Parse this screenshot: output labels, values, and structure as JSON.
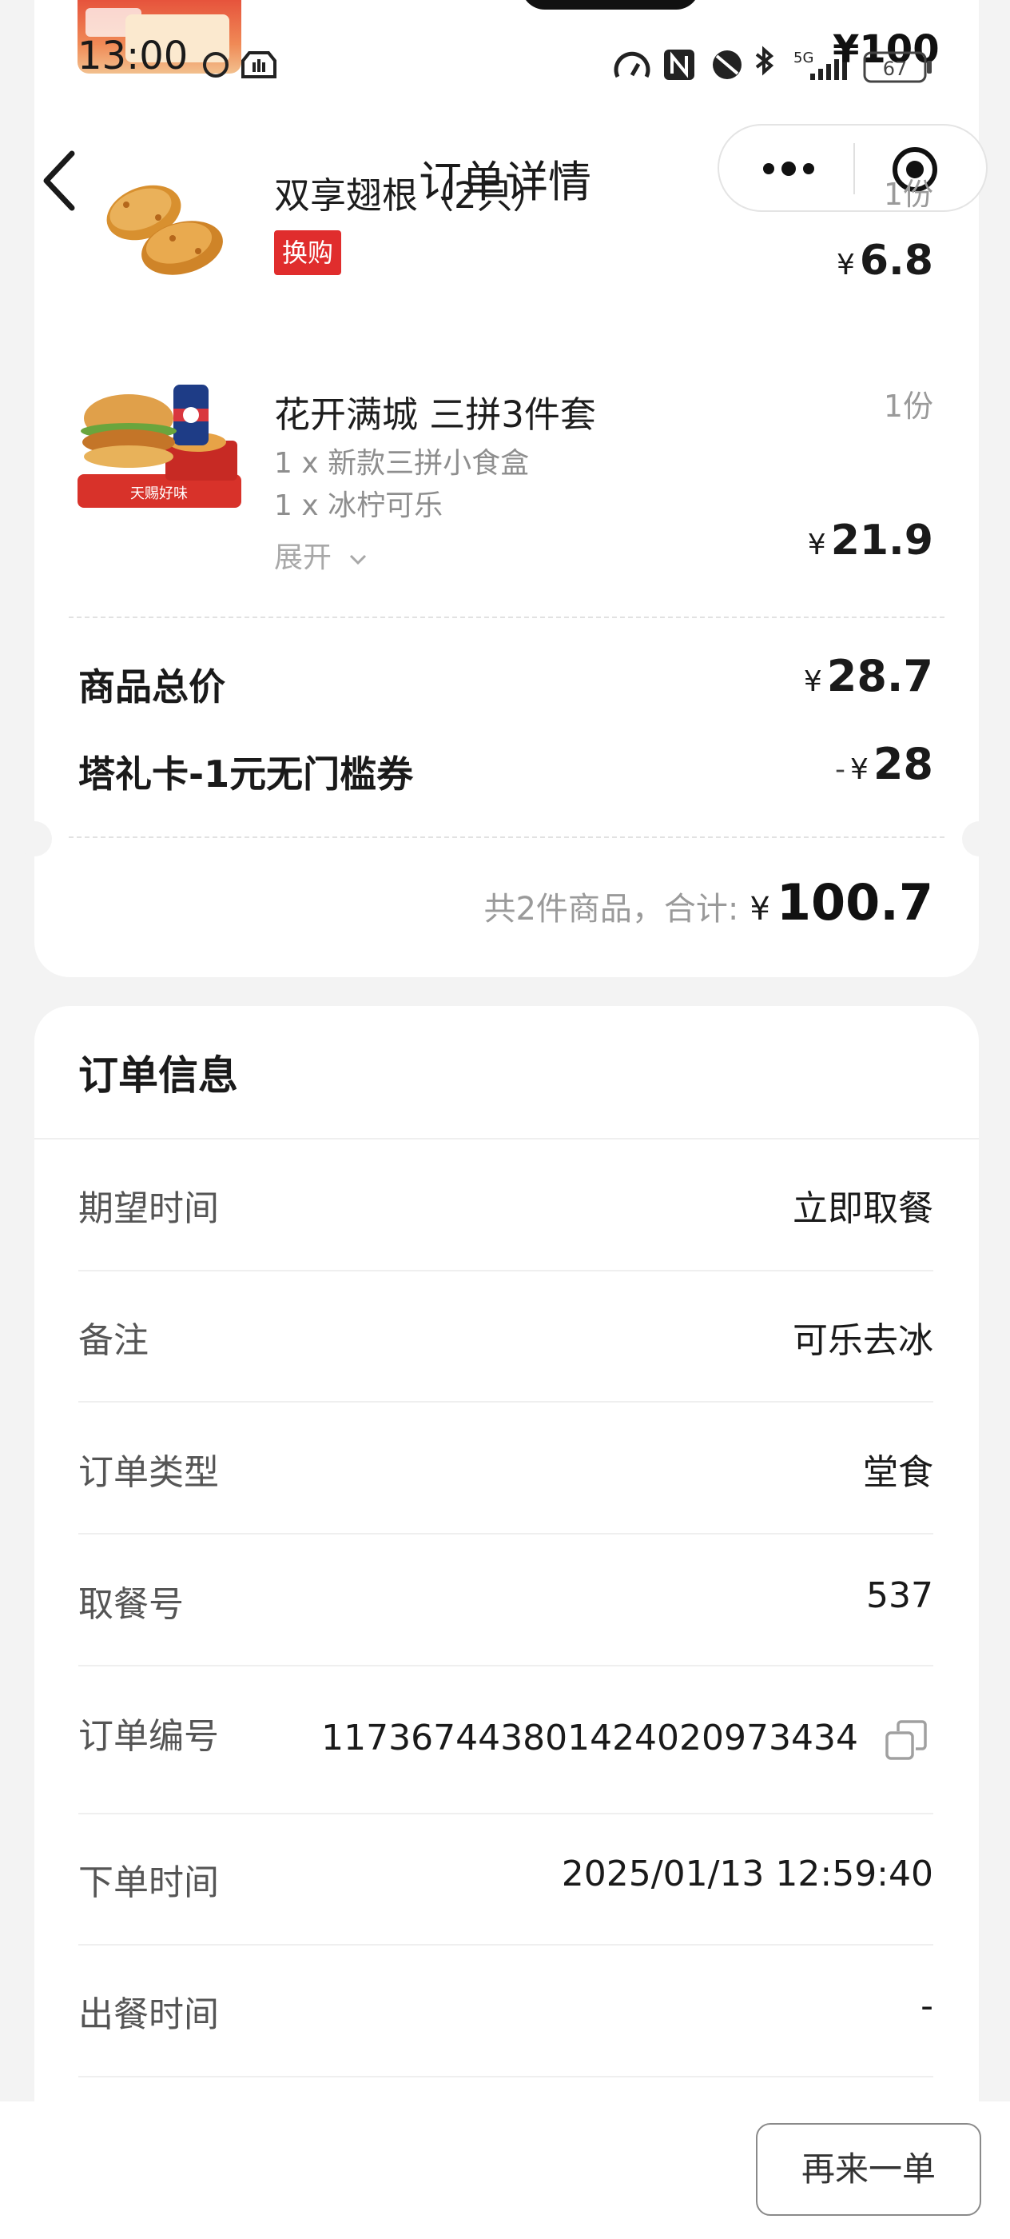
{
  "status_bar": {
    "time": "13:00",
    "battery": "¥100",
    "battery_level": "67"
  },
  "nav": {
    "title": "订单详情"
  },
  "items": [
    {
      "name": "双享翅根（2只）",
      "tag": "换购",
      "qty": "1份",
      "price": "6.8"
    },
    {
      "name": "花开满城 三拼3件套",
      "subs": [
        "1 x 新款三拼小食盒",
        "1 x 冰柠可乐"
      ],
      "expand_label": "展开",
      "qty": "1份",
      "price": "21.9",
      "image_text": "天赐好味"
    }
  ],
  "summary": {
    "goods_total_label": "商品总价",
    "goods_total_value": "28.7",
    "coupon_label": "塔礼卡-1元无门槛券",
    "coupon_minus": "-",
    "coupon_value": "28",
    "total_label": "共2件商品，合计:",
    "total_value": "100.7",
    "currency": "¥"
  },
  "order_info": {
    "title": "订单信息",
    "rows": [
      {
        "label": "期望时间",
        "value": "立即取餐"
      },
      {
        "label": "备注",
        "value": "可乐去冰"
      },
      {
        "label": "订单类型",
        "value": "堂食"
      },
      {
        "label": "取餐号",
        "value": "537"
      },
      {
        "label": "订单编号",
        "value": "1173674438014240209734​34"
      },
      {
        "label": "下单时间",
        "value": "2025/01/13 12:59:40"
      },
      {
        "label": "出餐时间",
        "value": "-"
      }
    ]
  },
  "bottom": {
    "reorder_label": "再来一单"
  },
  "colors": {
    "tag_red": "#e02d2d",
    "page_bg": "#f3f3f3",
    "card_bg": "#ffffff"
  }
}
